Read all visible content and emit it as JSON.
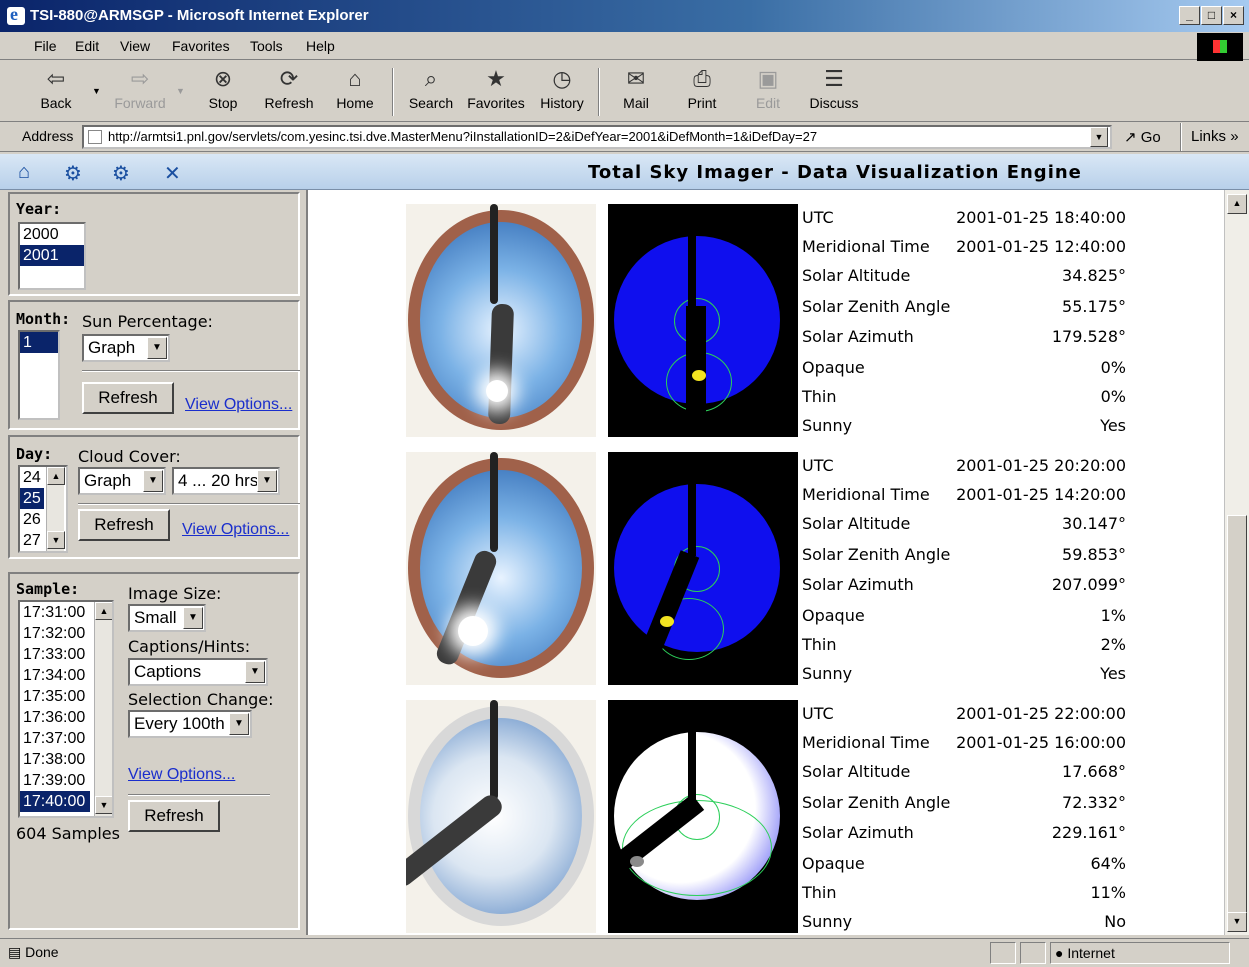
{
  "window": {
    "title": "TSI-880@ARMSGP - Microsoft Internet Explorer"
  },
  "menu": [
    "File",
    "Edit",
    "View",
    "Favorites",
    "Tools",
    "Help"
  ],
  "toolbar": {
    "back": "Back",
    "forward": "Forward",
    "stop": "Stop",
    "refresh": "Refresh",
    "home": "Home",
    "search": "Search",
    "favorites": "Favorites",
    "history": "History",
    "mail": "Mail",
    "print": "Print",
    "edit": "Edit",
    "discuss": "Discuss"
  },
  "address": {
    "label": "Address",
    "url": "http://armtsi1.pnl.gov/servlets/com.yesinc.tsi.dve.MasterMenu?iInstallationID=2&iDefYear=2001&iDefMonth=1&iDefDay=27",
    "go": "Go",
    "links": "Links"
  },
  "app": {
    "title": "Total Sky Imager - Data Visualization Engine"
  },
  "year": {
    "label": "Year:",
    "options": [
      "2000",
      "2001"
    ],
    "selected": "2001"
  },
  "month": {
    "label": "Month:",
    "options": [
      "1"
    ],
    "selected": "1",
    "sun_label": "Sun Percentage:",
    "sun_select": "Graph",
    "refresh": "Refresh",
    "view_options": "View Options..."
  },
  "day": {
    "label": "Day:",
    "options": [
      "24",
      "25",
      "26",
      "27"
    ],
    "selected": "25",
    "cloud_label": "Cloud Cover:",
    "cloud_select": "Graph",
    "range_select": "4 ... 20 hrs",
    "refresh": "Refresh",
    "view_options": "View Options..."
  },
  "sample": {
    "label": "Sample:",
    "options": [
      "17:31:00",
      "17:32:00",
      "17:33:00",
      "17:34:00",
      "17:35:00",
      "17:36:00",
      "17:37:00",
      "17:38:00",
      "17:39:00",
      "17:40:00"
    ],
    "selected": "17:40:00",
    "count": "604 Samples",
    "image_size_label": "Image Size:",
    "image_size": "Small",
    "captions_label": "Captions/Hints:",
    "captions": "Captions",
    "selection_label": "Selection Change:",
    "selection": "Every 100th",
    "view_options": "View Options...",
    "refresh": "Refresh"
  },
  "records": [
    {
      "rows": [
        {
          "k": "UTC",
          "v": "2001-01-25 18:40:00"
        },
        {
          "k": "Meridional Time",
          "v": "2001-01-25 12:40:00"
        },
        {
          "k": "Solar Altitude",
          "v": "34.825°"
        },
        {
          "k": "Solar Zenith Angle",
          "v": "55.175°"
        },
        {
          "k": "Solar Azimuth",
          "v": "179.528°"
        },
        {
          "k": "Opaque",
          "v": "0%"
        },
        {
          "k": "Thin",
          "v": "0%"
        },
        {
          "k": "Sunny",
          "v": "Yes"
        }
      ]
    },
    {
      "rows": [
        {
          "k": "UTC",
          "v": "2001-01-25 20:20:00"
        },
        {
          "k": "Meridional Time",
          "v": "2001-01-25 14:20:00"
        },
        {
          "k": "Solar Altitude",
          "v": "30.147°"
        },
        {
          "k": "Solar Zenith Angle",
          "v": "59.853°"
        },
        {
          "k": "Solar Azimuth",
          "v": "207.099°"
        },
        {
          "k": "Opaque",
          "v": "1%"
        },
        {
          "k": "Thin",
          "v": "2%"
        },
        {
          "k": "Sunny",
          "v": "Yes"
        }
      ]
    },
    {
      "rows": [
        {
          "k": "UTC",
          "v": "2001-01-25 22:00:00"
        },
        {
          "k": "Meridional Time",
          "v": "2001-01-25 16:00:00"
        },
        {
          "k": "Solar Altitude",
          "v": "17.668°"
        },
        {
          "k": "Solar Zenith Angle",
          "v": "72.332°"
        },
        {
          "k": "Solar Azimuth",
          "v": "229.161°"
        },
        {
          "k": "Opaque",
          "v": "64%"
        },
        {
          "k": "Thin",
          "v": "11%"
        },
        {
          "k": "Sunny",
          "v": "No"
        }
      ]
    }
  ],
  "status": {
    "text": "Done",
    "zone": "Internet"
  }
}
